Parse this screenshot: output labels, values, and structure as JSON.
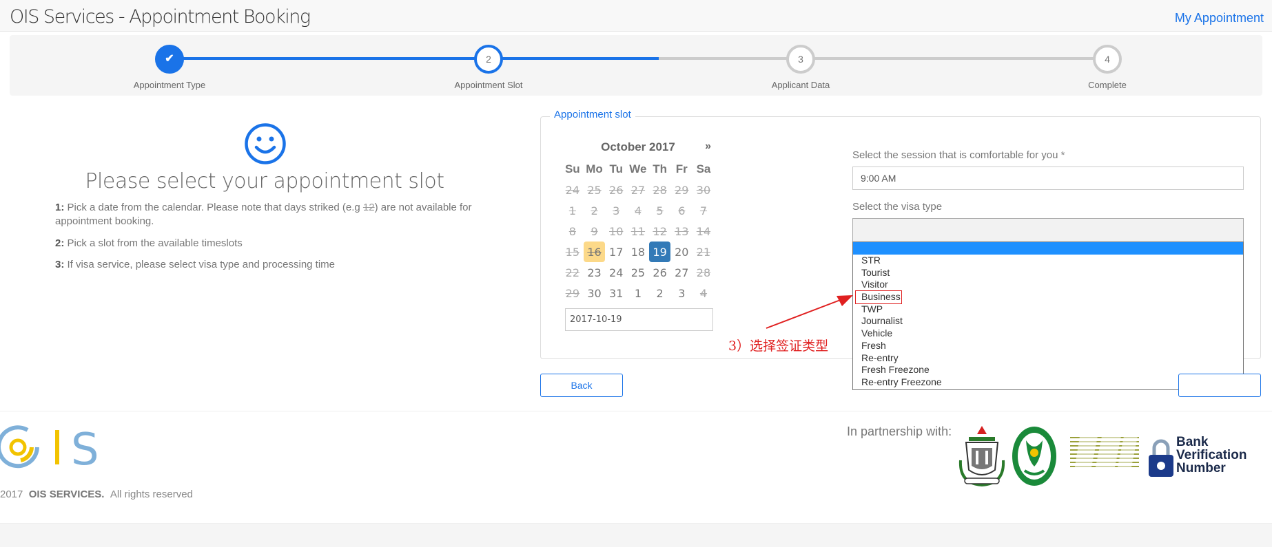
{
  "header": {
    "title": "OIS Services - Appointment Booking",
    "my_appointment": "My Appointment"
  },
  "wizard": {
    "steps": [
      {
        "num": "✔",
        "label": "Appointment Type"
      },
      {
        "num": "2",
        "label": "Appointment Slot"
      },
      {
        "num": "3",
        "label": "Applicant Data"
      },
      {
        "num": "4",
        "label": "Complete"
      }
    ]
  },
  "left": {
    "title": "Please select your appointment slot",
    "i1_num": "1:",
    "i1_a": " Pick a date from the calendar. Please note that days striked (e.g ",
    "i1_strike": "12",
    "i1_b": ") are not available for appointment booking.",
    "i2_num": "2:",
    "i2": " Pick a slot from the available timeslots",
    "i3_num": "3:",
    "i3": " If visa service, please select visa type and processing time"
  },
  "slot": {
    "legend": "Appointment slot",
    "calendar": {
      "month": "October 2017",
      "next": "»",
      "dow": [
        "Su",
        "Mo",
        "Tu",
        "We",
        "Th",
        "Fr",
        "Sa"
      ],
      "weeks": [
        [
          "24",
          "25",
          "26",
          "27",
          "28",
          "29",
          "30"
        ],
        [
          "1",
          "2",
          "3",
          "4",
          "5",
          "6",
          "7"
        ],
        [
          "8",
          "9",
          "10",
          "11",
          "12",
          "13",
          "14"
        ],
        [
          "15",
          "16",
          "17",
          "18",
          "19",
          "20",
          "21"
        ],
        [
          "22",
          "23",
          "24",
          "25",
          "26",
          "27",
          "28"
        ],
        [
          "29",
          "30",
          "31",
          "1",
          "2",
          "3",
          "4"
        ]
      ]
    },
    "date_value": "2017-10-19",
    "session_label": "Select the session that is comfortable for you",
    "session_required": "*",
    "session_value": "9:00 AM",
    "visa_label": "Select the visa type",
    "visa_options": [
      "STR",
      "Tourist",
      "Visitor",
      "Business",
      "TWP",
      "Journalist",
      "Vehicle",
      "Fresh",
      "Re-entry",
      "Fresh Freezone",
      "Re-entry Freezone"
    ]
  },
  "annotation": {
    "text": "3）选择签证类型",
    "color": "#e02020"
  },
  "buttons": {
    "back": "Back"
  },
  "footer": {
    "logo_text": "I S",
    "year": "2017",
    "company": "OIS SERVICES.",
    "rights": "All rights reserved",
    "partner": "In partnership with:",
    "bvn": [
      "Bank",
      "Verification",
      "Number"
    ]
  },
  "colors": {
    "accent": "#1a73e8",
    "today": "#fcd989",
    "selected": "#337ab7",
    "highlight": "#1e90ff"
  }
}
